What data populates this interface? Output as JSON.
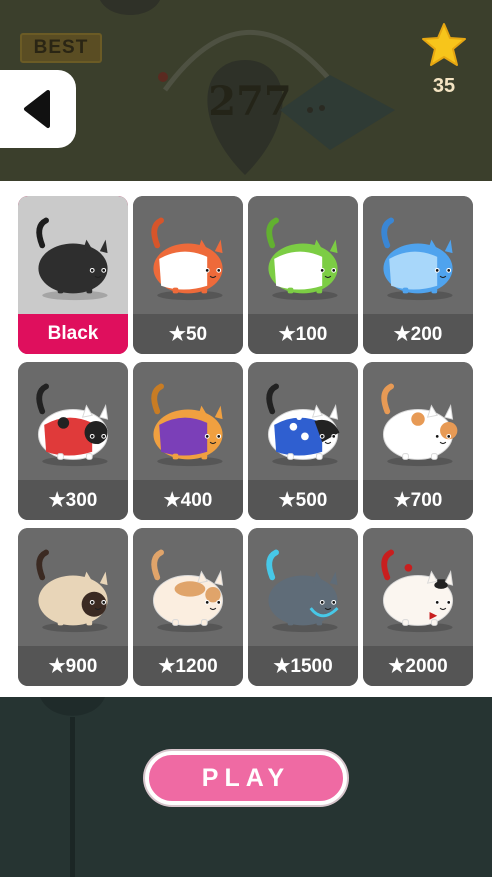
{
  "header": {
    "best_label": "BEST",
    "score": "277",
    "stars": "35"
  },
  "skins": [
    {
      "label": "Black",
      "selected": true,
      "body": "#2e2e2e",
      "band": "#2e2e2e",
      "accent": "#1d1d1d"
    },
    {
      "label": "★50",
      "selected": false,
      "body": "#ee6a3a",
      "band": "#ffffff",
      "accent": "#d7552a"
    },
    {
      "label": "★100",
      "selected": false,
      "body": "#7ccd44",
      "band": "#ffffff",
      "accent": "#62b030"
    },
    {
      "label": "★200",
      "selected": false,
      "body": "#4fa3ee",
      "band": "#a8d7fa",
      "accent": "#3a86d4"
    },
    {
      "label": "★300",
      "selected": false,
      "body": "#ffffff",
      "band": "#e03a3a",
      "accent": "#222222"
    },
    {
      "label": "★400",
      "selected": false,
      "body": "#f0a040",
      "band": "#7b3fb8",
      "accent": "#c87c24"
    },
    {
      "label": "★500",
      "selected": false,
      "body": "#ffffff",
      "band": "#2f5fd0",
      "accent": "#222222"
    },
    {
      "label": "★700",
      "selected": false,
      "body": "#ffffff",
      "band": "#ffffff",
      "accent": "#e79a55"
    },
    {
      "label": "★900",
      "selected": false,
      "body": "#e8d5b8",
      "band": "#e8d5b8",
      "accent": "#3b2a22"
    },
    {
      "label": "★1200",
      "selected": false,
      "body": "#fbeee0",
      "band": "#fbeee0",
      "accent": "#e0a46a"
    },
    {
      "label": "★1500",
      "selected": false,
      "body": "#5f6c78",
      "band": "#5f6c78",
      "accent": "#47c8e8"
    },
    {
      "label": "★2000",
      "selected": false,
      "body": "#fbf6f0",
      "band": "#fbf6f0",
      "accent": "#c81e1e"
    }
  ],
  "play_label": "PLAY"
}
